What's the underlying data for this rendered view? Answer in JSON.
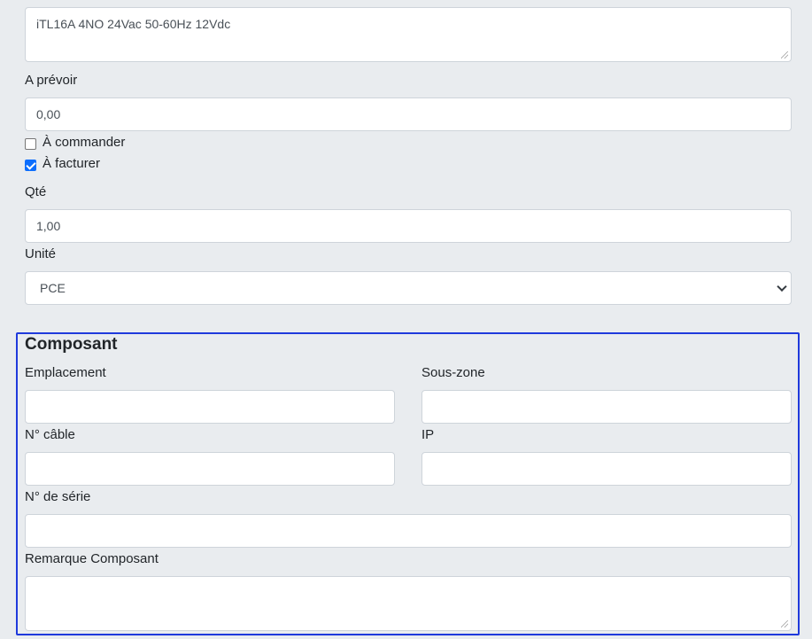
{
  "description": {
    "value": "iTL16A 4NO  24Vac 50-60Hz 12Vdc"
  },
  "a_prevoir": {
    "label": "A prévoir",
    "value": "0,00"
  },
  "a_commander": {
    "label": "À commander",
    "checked": false
  },
  "a_facturer": {
    "label": "À facturer",
    "checked": true
  },
  "qte": {
    "label": "Qté",
    "value": "1,00"
  },
  "unite": {
    "label": "Unité",
    "selected": "PCE"
  },
  "composant": {
    "title": "Composant",
    "emplacement": {
      "label": "Emplacement",
      "value": ""
    },
    "sous_zone": {
      "label": "Sous-zone",
      "value": ""
    },
    "cable": {
      "label": "N° câble",
      "value": ""
    },
    "ip": {
      "label": "IP",
      "value": ""
    },
    "serie": {
      "label": "N° de série",
      "value": ""
    },
    "remarque": {
      "label": "Remarque Composant",
      "value": ""
    }
  },
  "colors": {
    "background": "#e9ecef",
    "section_border": "#1f3adc",
    "checkbox_checked": "#0d6efd"
  }
}
